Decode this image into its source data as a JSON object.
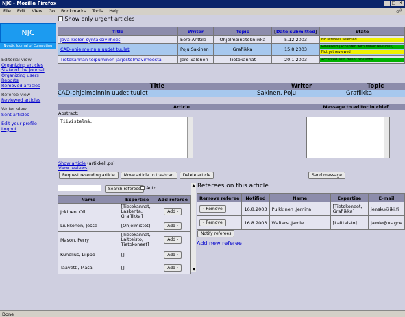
{
  "window": {
    "title": "NJC - Mozilla Firefox"
  },
  "menu": [
    "File",
    "Edit",
    "View",
    "Go",
    "Bookmarks",
    "Tools",
    "Help"
  ],
  "status": "Done",
  "brand": {
    "logo": "NJC",
    "subtitle": "Nordic Journal of Computing"
  },
  "nav": {
    "editorial_label": "Editorial view",
    "editorial_links": [
      "Organizing articles",
      "State of the journal",
      "Organizing users",
      "Reports",
      "Removed articles"
    ],
    "referee_label": "Referee view",
    "referee_links": [
      "Reviewed articles"
    ],
    "writer_label": "Writer view",
    "writer_links": [
      "Sent articles"
    ],
    "account_links": [
      "Edit your profile",
      "Logout"
    ]
  },
  "urgent_label": "Show only urgent articles",
  "articles": {
    "headers": [
      "Title",
      "Writer",
      "Topic",
      "Date submitted",
      "State"
    ],
    "rows": [
      {
        "title": "Java-kielen syntaksivirheet",
        "writer": "Eero Anttila",
        "topic": "Ohjelmointitekniikka",
        "date": "5.12.2003",
        "states": [
          {
            "text": "No referees selected",
            "color": "#f0f000"
          }
        ]
      },
      {
        "title": "CAD-ohjelmoinnin uudet tuulet",
        "writer": "Poju Sakinen",
        "topic": "Grafiikka",
        "date": "15.8.2003",
        "states": [
          {
            "text": "Reviewed (Accepted with minor revisions)",
            "color": "#00b000"
          },
          {
            "text": "Not yet reviewed",
            "color": "#f0f000"
          }
        ]
      },
      {
        "title": "Tietokannan toipuminen järjestelmävirheestä",
        "writer": "Jere Salonen",
        "topic": "Tietokannat",
        "date": "20.1.2003",
        "states": [
          {
            "text": "Accepted with minor revisions",
            "color": "#00b000"
          }
        ]
      }
    ]
  },
  "detail": {
    "headers": {
      "title": "Title",
      "writer": "Writer",
      "topic": "Topic"
    },
    "title": "CAD-ohjelmoinnin uudet tuulet",
    "writer": "Sakinen, Poju",
    "topic": "Grafiikka",
    "article_label": "Article",
    "message_label": "Message to editor in chief",
    "abstract_label": "Abstract:",
    "abstract_text": "Tiivistelmä.",
    "show_article": "Show article",
    "article_file": "(artikkeli.ps)",
    "view_reviews": "View reviews",
    "buttons": {
      "request": "Request resending article",
      "trash": "Move article to trashcan",
      "delete": "Delete article",
      "send": "Send message"
    }
  },
  "search": {
    "button": "Search referees",
    "auto": "Auto"
  },
  "candidates": {
    "headers": [
      "Name",
      "Expertise",
      "Add referee"
    ],
    "add_label": "Add",
    "rows": [
      {
        "name": "Jokinen, Olli",
        "expertise": "[Tietokannat, Laskenta, Grafiikka]"
      },
      {
        "name": "Liukkonen, Jesse",
        "expertise": "[Ohjelmistot]"
      },
      {
        "name": "Mason, Perry",
        "expertise": "[Tietokannat, Laitteisto, Tietokoneet]"
      },
      {
        "name": "Kunelius, Liippo",
        "expertise": "[]"
      },
      {
        "name": "Taavetti, Masa",
        "expertise": "[]"
      }
    ]
  },
  "referees": {
    "heading": "Referees on this article",
    "headers": [
      "Remove referee",
      "Notified",
      "Name",
      "Expertise",
      "E-mail"
    ],
    "remove_label": "Remove",
    "rows": [
      {
        "notified": "16.8.2003",
        "name": "Pulkkinen ,Jemina",
        "expertise": "[Tietokoneet, Grafiikka]",
        "email": "jensku@iki.fi"
      },
      {
        "notified": "16.8.2003",
        "name": "Walters ,Jamie",
        "expertise": "[Laitteisto]",
        "email": "jamie@us.gov"
      }
    ],
    "notify_button": "Notify referees",
    "add_new": "Add new referee"
  }
}
